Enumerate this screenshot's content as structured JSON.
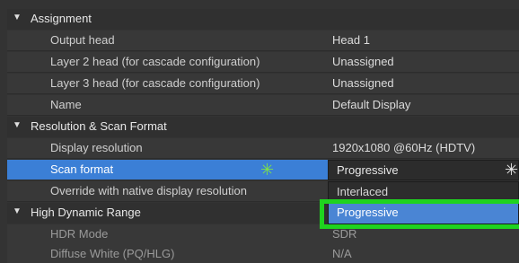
{
  "sections": {
    "assignment": {
      "title": "Assignment",
      "rows": [
        {
          "label": "Output head",
          "value": "Head 1"
        },
        {
          "label": "Layer 2 head (for cascade configuration)",
          "value": "Unassigned"
        },
        {
          "label": "Layer 3 head (for cascade configuration)",
          "value": "Unassigned"
        },
        {
          "label": "Name",
          "value": "Default Display"
        }
      ]
    },
    "resolution": {
      "title": "Resolution & Scan Format",
      "rows": [
        {
          "label": "Display resolution",
          "value": "1920x1080 @60Hz (HDTV)"
        },
        {
          "label": "Scan format",
          "value": "Progressive"
        },
        {
          "label": "Override with native display resolution",
          "value": ""
        }
      ]
    },
    "hdr": {
      "title": "High Dynamic Range",
      "rows": [
        {
          "label": "HDR Mode",
          "value": "SDR"
        },
        {
          "label": "Diffuse White (PQ/HLG)",
          "value": "N/A"
        }
      ]
    }
  },
  "scan_dropdown": {
    "options": [
      "Interlaced",
      "Progressive"
    ],
    "highlighted": "Progressive"
  },
  "colors": {
    "selection": "#3b7fd6",
    "highlight_box": "#1fd31f",
    "cursor_spark": "#7ee04a"
  },
  "icons": {
    "expand": "triangle-down-icon",
    "cursor": "click-spark-icon"
  }
}
